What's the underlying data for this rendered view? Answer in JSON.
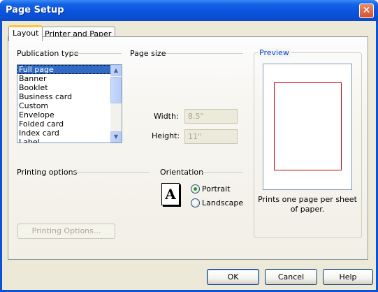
{
  "window": {
    "title": "Page Setup",
    "close_glyph": "✕"
  },
  "tabs": [
    {
      "label": "Layout",
      "active": true
    },
    {
      "label": "Printer and Paper",
      "active": false
    }
  ],
  "publication_type": {
    "label": "Publication type",
    "items": [
      "Full page",
      "Banner",
      "Booklet",
      "Business card",
      "Custom",
      "Envelope",
      "Folded card",
      "Index card",
      "Label"
    ],
    "selected": "Full page"
  },
  "page_size": {
    "label": "Page size",
    "width_label": "Width:",
    "width_value": "8.5\"",
    "height_label": "Height:",
    "height_value": "11\""
  },
  "printing_options": {
    "label": "Printing options",
    "button_label": "Printing Options..."
  },
  "orientation": {
    "label": "Orientation",
    "icon_letter": "A",
    "options": [
      {
        "label": "Portrait",
        "checked": true
      },
      {
        "label": "Landscape",
        "checked": false
      }
    ]
  },
  "preview": {
    "label": "Preview",
    "caption": "Prints one page per sheet of paper."
  },
  "buttons": {
    "ok": "OK",
    "cancel": "Cancel",
    "help": "Help"
  },
  "colors": {
    "title_bar": "#0a53d8",
    "dialog_bg": "#ece9d8",
    "selection": "#316ac5",
    "margin_guide": "#c20000",
    "group_label_blue": "#0046d5"
  }
}
